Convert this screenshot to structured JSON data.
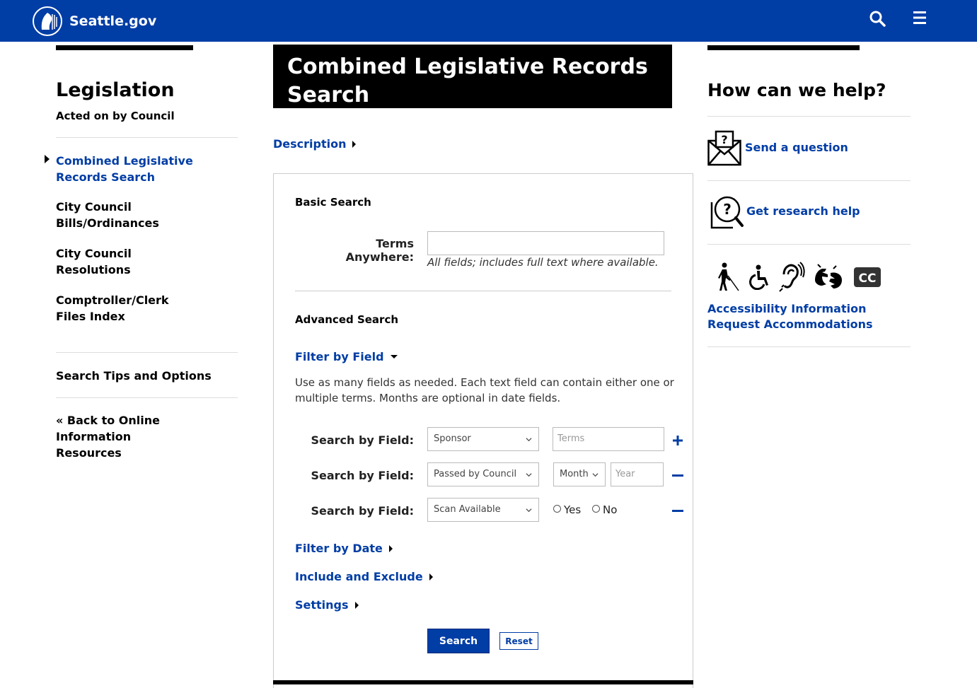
{
  "header": {
    "site_name": "Seattle.gov",
    "logo_icon": "city-seal-icon",
    "search_icon": "search-icon",
    "menu_icon": "hamburger-menu-icon",
    "brand_color": "#003da5"
  },
  "sidebar": {
    "title": "Legislation",
    "subtitle": "Acted on by Council",
    "items": [
      {
        "label": "Combined Legislative Records Search",
        "active": true
      },
      {
        "label": "City Council Bills/Ordinances"
      },
      {
        "label": "City Council Resolutions"
      },
      {
        "label": "Comptroller/Clerk Files Index"
      }
    ],
    "search_tips": "Search Tips and Options",
    "back_link": "« Back to Online Information Resources"
  },
  "main": {
    "title": "Combined Legislative Records Search",
    "description_link": "Description",
    "basic_search": {
      "heading": "Basic Search",
      "terms_label": "Terms Anywhere:",
      "terms_value": "",
      "hint": "All fields; includes full text where available."
    },
    "advanced_search": {
      "heading": "Advanced Search",
      "filter_by_field": "Filter by Field",
      "help_text": "Use as many fields as needed. Each text field can contain either one or multiple terms. Months are optional in date fields.",
      "rows": [
        {
          "label": "Search by Field:",
          "field": "Sponsor",
          "terms_placeholder": "Terms"
        },
        {
          "label": "Search by Field:",
          "field": "Passed by Council",
          "month": "Month",
          "year_placeholder": "Year"
        },
        {
          "label": "Search by Field:",
          "field": "Scan Available",
          "yes": "Yes",
          "no": "No"
        }
      ],
      "filter_by_date": "Filter by Date",
      "include_exclude": "Include and Exclude",
      "settings": "Settings"
    },
    "buttons": {
      "search": "Search",
      "reset": "Reset"
    }
  },
  "help": {
    "title": "How can we help?",
    "send_question": "Send a question",
    "research_help": "Get research help",
    "accessibility_icons": [
      "blind-cane-icon",
      "wheelchair-icon",
      "hearing-assist-icon",
      "sign-language-icon",
      "closed-caption-icon"
    ],
    "cc_text": "CC",
    "accessibility_info": "Accessibility Information",
    "request_accommodations": "Request Accommodations"
  }
}
